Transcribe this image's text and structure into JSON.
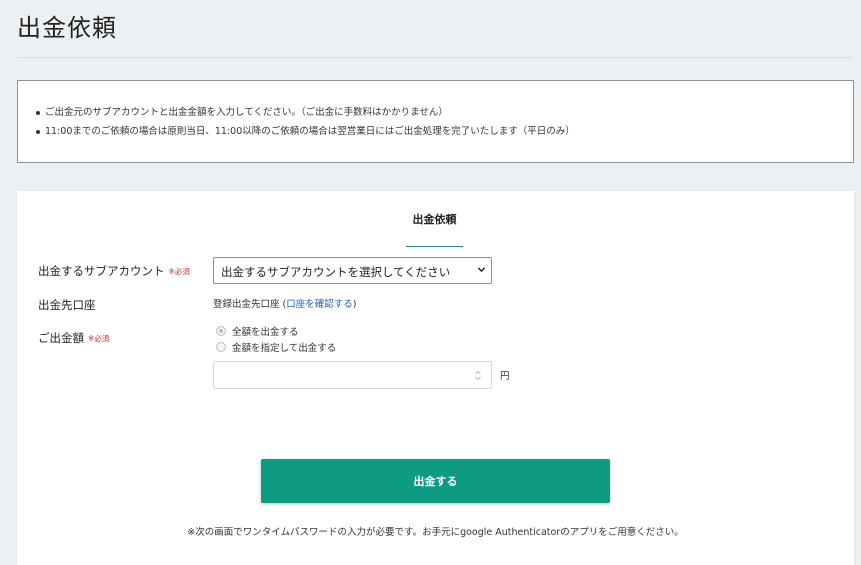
{
  "page": {
    "title": "出金依頼"
  },
  "notice": {
    "items": [
      "ご出金元のサブアカウントと出金金額を入力してください。（ご出金に手数料はかかりません）",
      "11:00までのご依頼の場合は原則当日、11:00以降のご依頼の場合は翌営業日にはご出金処理を完了いたします（平日のみ）"
    ]
  },
  "form": {
    "tab_label": "出金依頼",
    "required_mark": "※必須",
    "subaccount": {
      "label": "出金するサブアカウント",
      "selected": "出金するサブアカウントを選択してください"
    },
    "destination": {
      "label": "出金先口座",
      "value_prefix": "登録出金先口座 (",
      "link_text": "口座を確認する",
      "value_suffix": ")"
    },
    "amount": {
      "label": "ご出金額",
      "options": [
        "全額を出金する",
        "金額を指定して出金する"
      ],
      "selected_index": 0,
      "value": "",
      "unit": "円"
    },
    "submit_label": "出金する",
    "footnote": "※次の画面でワンタイムパスワードの入力が必要です。お手元にgoogle Authenticatorのアプリをご用意ください。"
  },
  "colors": {
    "accent": "#0e9b82",
    "tab_underline": "#2a8c86",
    "required": "#d0312d",
    "link": "#1f5fa8"
  },
  "icons": {
    "select_arrow": "chevron-down-icon",
    "number_spinner": "spinner-icon"
  }
}
